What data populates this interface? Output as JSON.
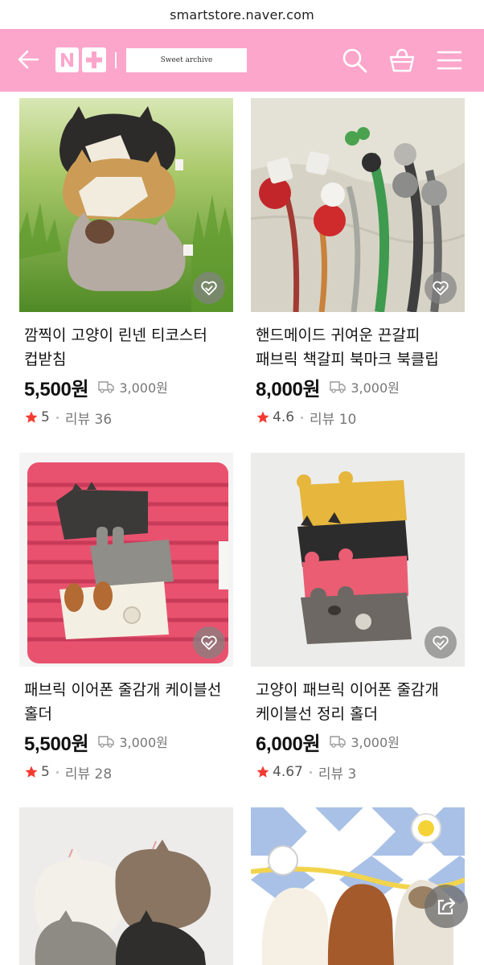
{
  "browser": {
    "url": "smartstore.naver.com"
  },
  "header": {
    "bg_color": "#fca6cb",
    "back_icon": "arrow-left-icon",
    "logo_text": "N+",
    "store_name": "Sweet archive",
    "search_icon": "search-icon",
    "cart_icon": "shopping-basket-icon",
    "menu_icon": "hamburger-menu-icon"
  },
  "products": [
    {
      "name_line1": "깜찍이 고양이 린넨 티코스터",
      "name_line2": "컵받침",
      "price": "5,500원",
      "shipping": "3,000원",
      "rating": "5",
      "reviews": "리뷰 36"
    },
    {
      "name_line1": "핸드메이드 귀여운 끈갈피",
      "name_line2": "패브릭 책갈피 북마크 북클립",
      "price": "8,000원",
      "shipping": "3,000원",
      "rating": "4.6",
      "reviews": "리뷰 10"
    },
    {
      "name_line1": "패브릭 이어폰 줄감개 케이블선",
      "name_line2": "홀더",
      "price": "5,500원",
      "shipping": "3,000원",
      "rating": "5",
      "reviews": "리뷰 28"
    },
    {
      "name_line1": "고양이 패브릭 이어폰 줄감개",
      "name_line2": "케이블선 정리 홀더",
      "price": "6,000원",
      "shipping": "3,000원",
      "rating": "4.67",
      "reviews": "리뷰 3"
    }
  ],
  "icons": {
    "favorite": "heart-check-icon",
    "shipping": "truck-icon",
    "rating": "star-icon",
    "share": "share-icon"
  },
  "colors": {
    "star": "#f23b30",
    "accent_pink": "#fca6cb"
  }
}
